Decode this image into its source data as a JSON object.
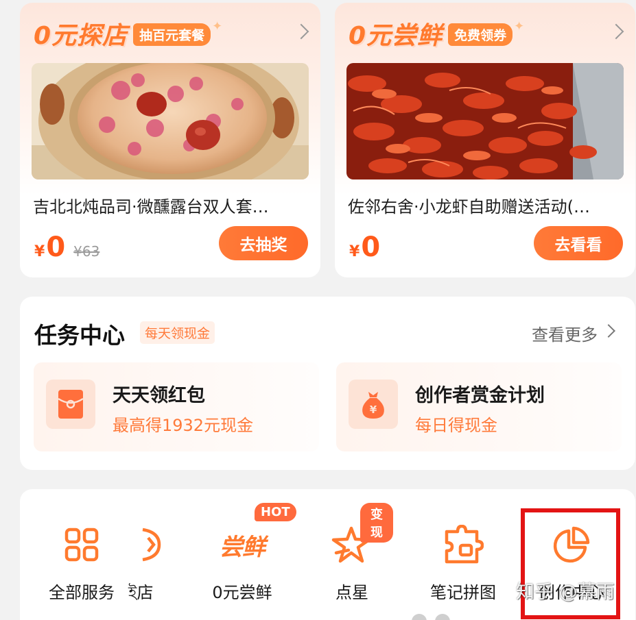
{
  "deals": [
    {
      "title": "0元探店",
      "tag": "抽百元套餐",
      "name": "吉北北炖品司·微醺露台双人套…",
      "price_symbol": "¥",
      "price": "0",
      "original_price": "¥63",
      "button": "去抽奖"
    },
    {
      "title": "0元尝鲜",
      "tag": "免费领券",
      "name": "佐邻右舍·小龙虾自助赠送活动(…",
      "price_symbol": "¥",
      "price": "0",
      "original_price": "",
      "button": "去看看"
    }
  ],
  "task_center": {
    "title": "任务中心",
    "badge": "每天领现金",
    "more": "查看更多",
    "items": [
      {
        "name": "天天领红包",
        "subtitle": "最高得1932元现金",
        "icon": "red-envelope-icon"
      },
      {
        "name": "创作者赏金计划",
        "subtitle": "每日得现金",
        "icon": "money-bag-icon"
      }
    ]
  },
  "services": [
    {
      "label": "全部服务",
      "icon": "grid-icon",
      "tag": ""
    },
    {
      "label": "ই店",
      "icon": "shop-icon",
      "tag": ""
    },
    {
      "label": "0元尝鲜",
      "icon": "taste-logo-icon",
      "icon_text": "尝鲜",
      "tag": "HOT"
    },
    {
      "label": "点星",
      "icon": "star-icon",
      "tag": "变现"
    },
    {
      "label": "笔记拼图",
      "icon": "puzzle-icon",
      "tag": ""
    },
    {
      "label": "创作中心",
      "icon": "pie-chart-icon",
      "tag": ""
    }
  ],
  "watermark": "知乎 @幕雨",
  "colors": {
    "accent": "#ff7a2e",
    "price": "#ff5a1a",
    "highlight_frame": "#e31414"
  }
}
